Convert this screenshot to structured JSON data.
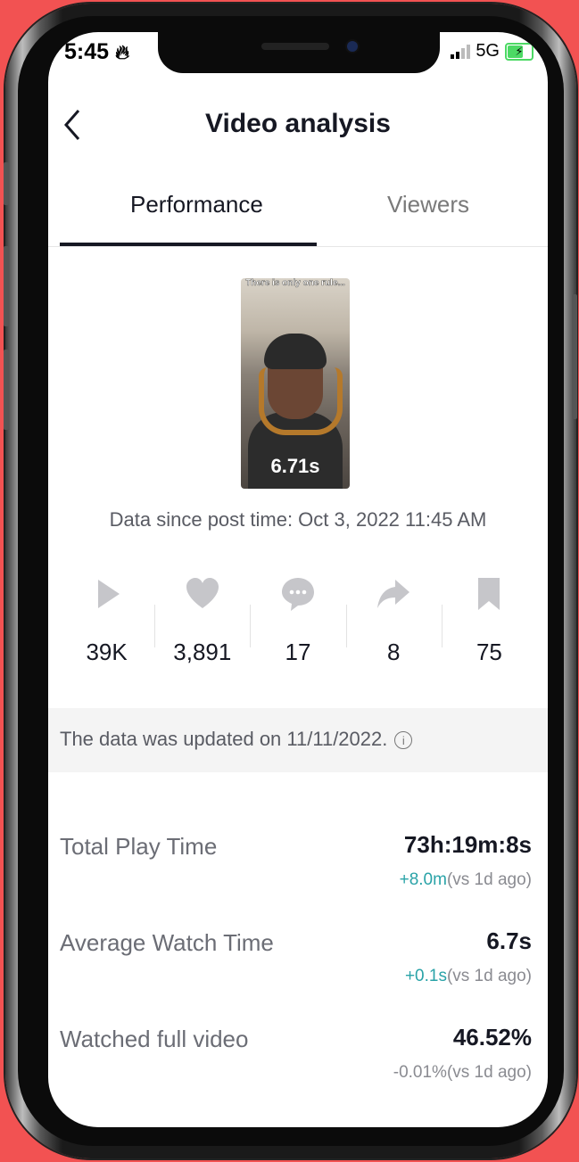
{
  "status_bar": {
    "time": "5:45",
    "network": "5G"
  },
  "header": {
    "title": "Video analysis"
  },
  "tabs": [
    {
      "label": "Performance",
      "active": true
    },
    {
      "label": "Viewers",
      "active": false
    }
  ],
  "video": {
    "caption": "There is only one rule...",
    "duration": "6.71s"
  },
  "data_since": "Data since post time: Oct 3, 2022 11:45 AM",
  "stats": [
    {
      "icon": "play-icon",
      "value": "39K"
    },
    {
      "icon": "heart-icon",
      "value": "3,891"
    },
    {
      "icon": "comment-icon",
      "value": "17"
    },
    {
      "icon": "share-icon",
      "value": "8"
    },
    {
      "icon": "bookmark-icon",
      "value": "75"
    }
  ],
  "notice": {
    "text": "The data was updated on 11/11/2022."
  },
  "metrics": [
    {
      "label": "Total Play Time",
      "value": "73h:19m:8s",
      "delta": "+8.0m",
      "delta_note": "(vs 1d ago)"
    },
    {
      "label": "Average Watch Time",
      "value": "6.7s",
      "delta": "+0.1s",
      "delta_note": "(vs 1d ago)"
    },
    {
      "label": "Watched full video",
      "value": "46.52%",
      "delta": "-0.01%",
      "delta_note": "(vs 1d ago)"
    }
  ],
  "colors": {
    "background": "#f25252",
    "accent_positive": "#2aa3a8",
    "text_primary": "#161823"
  }
}
